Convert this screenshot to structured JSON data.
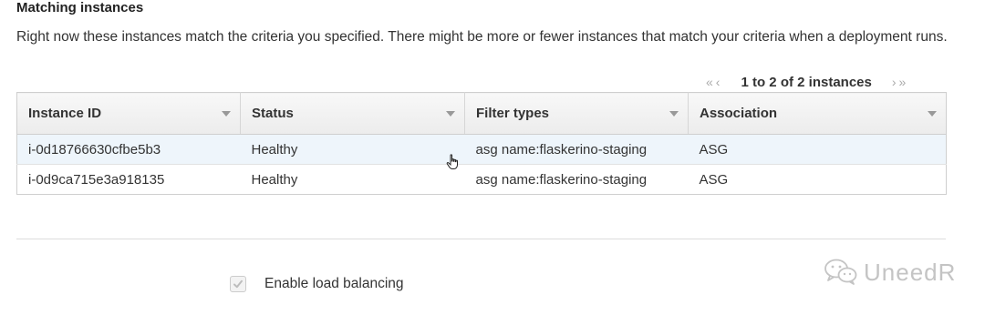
{
  "section": {
    "title": "Matching instances",
    "description": "Right now these instances match the criteria you specified. There might be more or fewer instances that match your criteria when a deployment runs."
  },
  "pagination": {
    "first_icon": "«",
    "prev_icon": "‹",
    "range_text": "1 to 2 of 2 instances",
    "next_icon": "›",
    "last_icon": "»"
  },
  "table": {
    "columns": [
      "Instance ID",
      "Status",
      "Filter types",
      "Association"
    ],
    "rows": [
      {
        "instance_id": "i-0d18766630cfbe5b3",
        "status": "Healthy",
        "filter_types": "asg name:flaskerino-staging",
        "association": "ASG"
      },
      {
        "instance_id": "i-0d9ca715e3a918135",
        "status": "Healthy",
        "filter_types": "asg name:flaskerino-staging",
        "association": "ASG"
      }
    ]
  },
  "load_balancing": {
    "label": "Enable load balancing",
    "checked": true,
    "disabled": true
  },
  "watermark": {
    "text": "UneedR",
    "icon": "wechat-icon"
  },
  "colors": {
    "row_hover": "#eef5fb",
    "header_bg": "#f0f0f0",
    "border": "#cfcfcf"
  }
}
